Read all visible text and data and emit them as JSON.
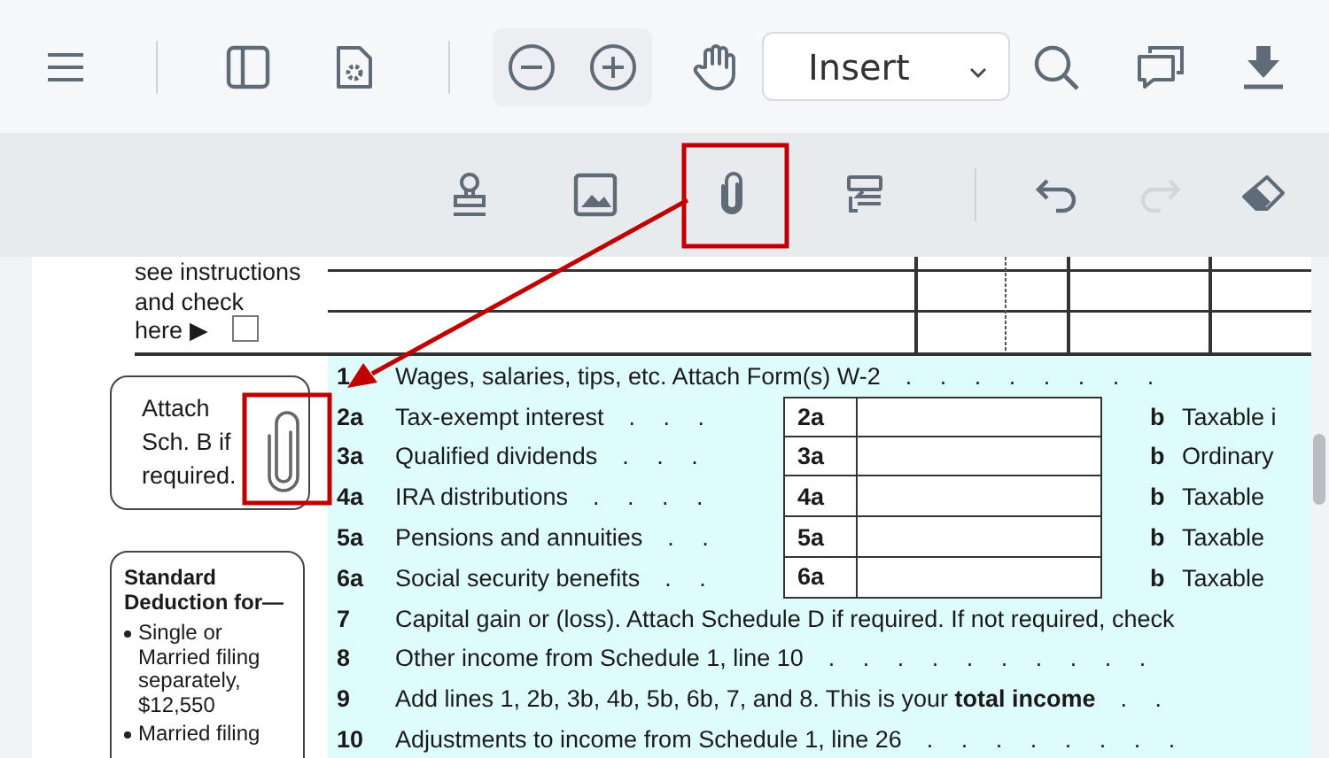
{
  "top_toolbar": {
    "mode_dropdown": {
      "value": "Insert"
    }
  },
  "edit_toolbar": {
    "undo": {
      "disabled": false
    },
    "redo": {
      "disabled": true
    }
  },
  "form": {
    "note_lines": [
      "see instructions",
      "and check",
      "here ▶"
    ],
    "note_checkbox": {
      "checked": false
    },
    "attach_note": [
      "Attach",
      "Sch. B if",
      "required."
    ],
    "standard_deduction": {
      "title": "Standard Deduction for—",
      "items": [
        "Single or Married filing separately, $12,550",
        "Married filing"
      ]
    },
    "income_lines": [
      {
        "number": "1",
        "label": "Wages, salaries, tips, etc. Attach Form(s) W-2",
        "leader": ". . . . . . . ."
      },
      {
        "number": "2a",
        "label": "Tax-exempt interest",
        "leader": ". . .",
        "box_number": "2a",
        "b_letter": "b",
        "b_label": "Taxable i"
      },
      {
        "number": "3a",
        "label": "Qualified dividends",
        "leader": ". . .",
        "box_number": "3a",
        "b_letter": "b",
        "b_label": "Ordinary"
      },
      {
        "number": "4a",
        "label": "IRA distributions",
        "leader": ". . . .",
        "box_number": "4a",
        "b_letter": "b",
        "b_label": "Taxable"
      },
      {
        "number": "5a",
        "label": "Pensions and annuities",
        "leader": ". .",
        "box_number": "5a",
        "b_letter": "b",
        "b_label": "Taxable"
      },
      {
        "number": "6a",
        "label": "Social security benefits",
        "leader": ". .",
        "box_number": "6a",
        "b_letter": "b",
        "b_label": "Taxable"
      },
      {
        "number": "7",
        "label": "Capital gain or (loss). Attach Schedule D if required. If not required, check"
      },
      {
        "number": "8",
        "label": "Other income from Schedule 1, line 10",
        "leader": ". . . . . . . . . ."
      },
      {
        "number": "9",
        "label": "Add lines 1, 2b, 3b, 4b, 5b, 6b, 7, and 8. This is your **total income**",
        "leader": ". ."
      },
      {
        "number": "10",
        "label": "Adjustments to income from Schedule 1, line 26",
        "leader": ". . . . . . . ."
      }
    ]
  }
}
